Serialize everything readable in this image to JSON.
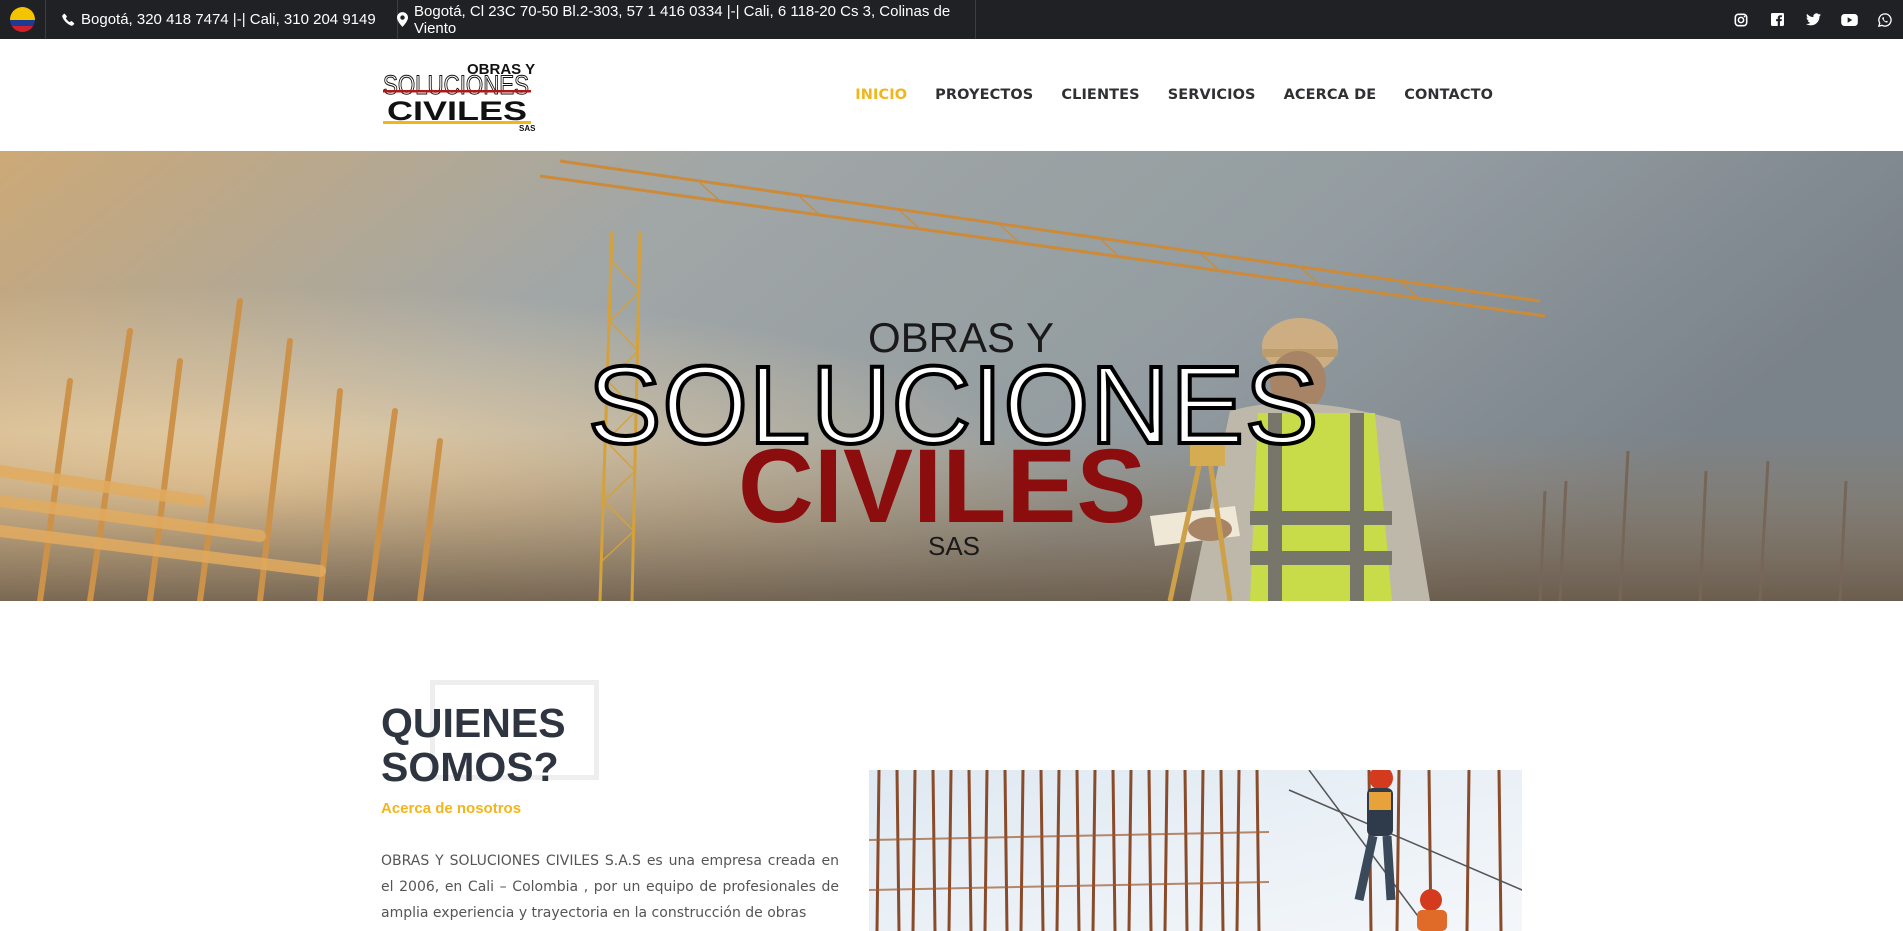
{
  "topbar": {
    "flag_icon": "colombia-flag-icon",
    "phones": "Bogotá, 320 418 7474 |-| Cali, 310 204 9149",
    "address": "Bogotá, Cl 23C 70-50 Bl.2-303, 57 1 416 0334 |-| Cali, 6 118-20 Cs 3, Colinas de Viento",
    "social_icons": [
      "instagram-icon",
      "facebook-icon",
      "twitter-icon",
      "youtube-icon",
      "whatsapp-icon"
    ]
  },
  "header": {
    "logo": {
      "line1": "OBRAS Y",
      "line2": "SOLUCIONES",
      "line3": "CIVILES",
      "suffix": "SAS"
    },
    "nav": [
      {
        "label": "INICIO",
        "active": true
      },
      {
        "label": "PROYECTOS",
        "active": false
      },
      {
        "label": "CLIENTES",
        "active": false
      },
      {
        "label": "SERVICIOS",
        "active": false
      },
      {
        "label": "ACERCA DE",
        "active": false
      },
      {
        "label": "CONTACTO",
        "active": false
      }
    ]
  },
  "hero": {
    "line1": "OBRAS Y",
    "line2": "SOLUCIONES",
    "line3": "CIVILES",
    "line4": "SAS"
  },
  "about": {
    "title": "QUIENES SOMOS?",
    "subtitle": "Acerca de nosotros",
    "body": "OBRAS Y SOLUCIONES CIVILES S.A.S es una empresa creada en el 2006, en Cali – Colombia , por un equipo de profesionales de amplia experiencia y trayectoria en la construcción de obras"
  },
  "colors": {
    "accent": "#f2b51a",
    "topbar_bg": "#1f2124",
    "brand_red": "#8b0d0d",
    "heading": "#2e3540"
  }
}
